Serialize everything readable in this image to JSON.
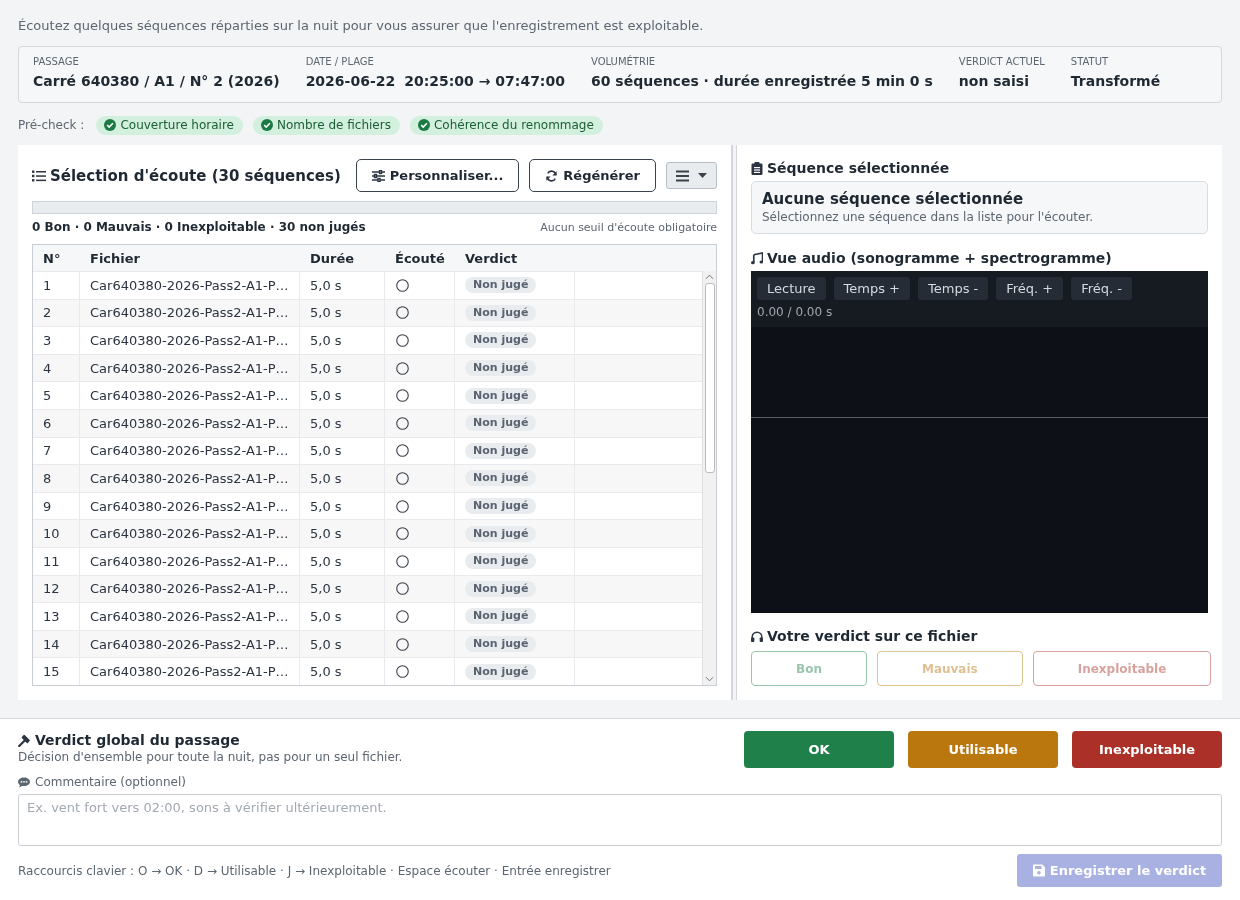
{
  "intro": "Écoutez quelques séquences réparties sur la nuit pour vous assurer que l'enregistrement est exploitable.",
  "summary_card": {
    "fields": [
      {
        "label": "PASSAGE",
        "values": [
          "Carré 640380 / A1 / N° 2 (2026)"
        ]
      },
      {
        "label": "DATE / PLAGE",
        "values": [
          "2026-06-22",
          "20:25:00 → 07:47:00"
        ]
      },
      {
        "label": "VOLUMÉTRIE",
        "values": [
          "60 séquences · durée enregistrée 5 min 0 s"
        ]
      },
      {
        "label": "VERDICT ACTUEL",
        "values": [
          "non saisi"
        ]
      },
      {
        "label": "STATUT",
        "values": [
          "Transformé"
        ]
      }
    ]
  },
  "precheck": {
    "label": "Pré-check :",
    "checks": [
      {
        "label": "Couverture horaire",
        "passed": true
      },
      {
        "label": "Nombre de fichiers",
        "passed": true
      },
      {
        "label": "Cohérence du renommage",
        "passed": true
      }
    ]
  },
  "selection": {
    "title": "Sélection d'écoute (30 séquences)",
    "buttons": [
      "Personnaliser...",
      "Régénérer"
    ],
    "progress": {
      "level": 0
    },
    "tally": "0 Bon · 0 Mauvais · 0 Inexploitable · 30 non jugés",
    "threshold_note": "Aucun seuil d'écoute obligatoire"
  },
  "table": {
    "columns": [
      "N°",
      "Fichier",
      "Durée",
      "Écouté",
      "Verdict"
    ],
    "rows": [
      {
        "number": "1",
        "file": "Car640380-2026-Pass2-A1-P…",
        "duration": "5,0 s",
        "listened": false,
        "verdict": "Non jugé",
        "selected": false
      },
      {
        "number": "2",
        "file": "Car640380-2026-Pass2-A1-P…",
        "duration": "5,0 s",
        "listened": false,
        "verdict": "Non jugé",
        "selected": false
      },
      {
        "number": "3",
        "file": "Car640380-2026-Pass2-A1-P…",
        "duration": "5,0 s",
        "listened": false,
        "verdict": "Non jugé",
        "selected": false
      },
      {
        "number": "4",
        "file": "Car640380-2026-Pass2-A1-P…",
        "duration": "5,0 s",
        "listened": false,
        "verdict": "Non jugé",
        "selected": false
      },
      {
        "number": "5",
        "file": "Car640380-2026-Pass2-A1-P…",
        "duration": "5,0 s",
        "listened": false,
        "verdict": "Non jugé",
        "selected": false
      },
      {
        "number": "6",
        "file": "Car640380-2026-Pass2-A1-P…",
        "duration": "5,0 s",
        "listened": false,
        "verdict": "Non jugé",
        "selected": false
      },
      {
        "number": "7",
        "file": "Car640380-2026-Pass2-A1-P…",
        "duration": "5,0 s",
        "listened": false,
        "verdict": "Non jugé",
        "selected": false
      },
      {
        "number": "8",
        "file": "Car640380-2026-Pass2-A1-P…",
        "duration": "5,0 s",
        "listened": false,
        "verdict": "Non jugé",
        "selected": false
      },
      {
        "number": "9",
        "file": "Car640380-2026-Pass2-A1-P…",
        "duration": "5,0 s",
        "listened": false,
        "verdict": "Non jugé",
        "selected": false
      },
      {
        "number": "10",
        "file": "Car640380-2026-Pass2-A1-P…",
        "duration": "5,0 s",
        "listened": false,
        "verdict": "Non jugé",
        "selected": false
      },
      {
        "number": "11",
        "file": "Car640380-2026-Pass2-A1-P…",
        "duration": "5,0 s",
        "listened": false,
        "verdict": "Non jugé",
        "selected": false
      },
      {
        "number": "12",
        "file": "Car640380-2026-Pass2-A1-P…",
        "duration": "5,0 s",
        "listened": false,
        "verdict": "Non jugé",
        "selected": false
      },
      {
        "number": "13",
        "file": "Car640380-2026-Pass2-A1-P…",
        "duration": "5,0 s",
        "listened": false,
        "verdict": "Non jugé",
        "selected": false
      },
      {
        "number": "14",
        "file": "Car640380-2026-Pass2-A1-P…",
        "duration": "5,0 s",
        "listened": false,
        "verdict": "Non jugé",
        "selected": false
      },
      {
        "number": "15",
        "file": "Car640380-2026-Pass2-A1-P…",
        "duration": "5,0 s",
        "listened": false,
        "verdict": "Non jugé",
        "selected": false
      }
    ]
  },
  "selected_sequence": {
    "heading": "Séquence sélectionnée",
    "title": "Aucune séquence sélectionnée",
    "hint": "Sélectionnez une séquence dans la liste pour l'écouter."
  },
  "audio_view": {
    "heading": "Vue audio (sonogramme + spectrogramme)",
    "controls": [
      "Lecture",
      "Temps +",
      "Temps -",
      "Fréq. +",
      "Fréq. -"
    ],
    "time": "0.00 / 0.00 s"
  },
  "file_verdict": {
    "heading": "Votre verdict sur ce fichier",
    "options": [
      {
        "label": "Bon",
        "kind": "good",
        "selected": false,
        "disabled": true
      },
      {
        "label": "Mauvais",
        "kind": "medium",
        "selected": false,
        "disabled": true
      },
      {
        "label": "Inexploitable",
        "kind": "bad",
        "selected": false,
        "disabled": true
      }
    ]
  },
  "global_verdict": {
    "title": "Verdict global du passage",
    "subtitle": "Décision d'ensemble pour toute la nuit, pas pour un seul fichier.",
    "options": [
      {
        "label": "OK",
        "kind": "good",
        "selected": false
      },
      {
        "label": "Utilisable",
        "kind": "medium",
        "selected": false
      },
      {
        "label": "Inexploitable",
        "kind": "bad",
        "selected": false
      }
    ],
    "comment": {
      "label": "Commentaire (optionnel)",
      "placeholder": "Ex. vent fort vers 02:00, sons à vérifier ultérieurement."
    },
    "shortcuts": "Raccourcis clavier : O → OK · D → Utilisable · J → Inexploitable · Espace écouter · Entrée enregistrer",
    "save_button": {
      "label": "Enregistrer le verdict",
      "disabled": true
    }
  }
}
